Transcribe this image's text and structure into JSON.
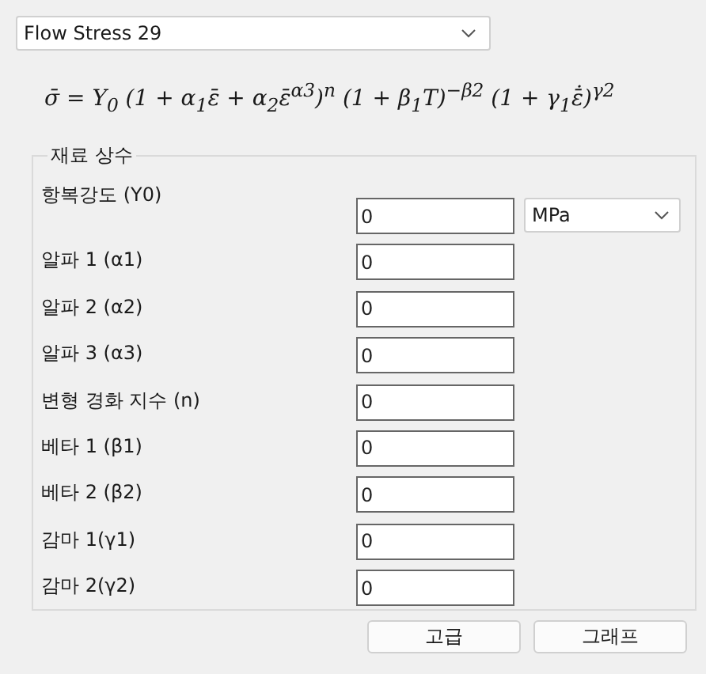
{
  "model_select": {
    "value": "Flow Stress 29"
  },
  "formula": "σ̄ = Y$_{0}$ (1 + α$_{1}$ε̄ + α$_{2}$ε̄$^{α3}$)$^{n}$ (1 + β$_{1}$T)$^{−β2}$ (1 + γ$_{1}$ε̄̇)$^{γ2}$",
  "group": {
    "title": "재료 상수",
    "parameters": [
      {
        "label": "항복강도 (Y0)",
        "value": "0",
        "unit": "MPa"
      },
      {
        "label": "알파 1 (α1)",
        "value": "0"
      },
      {
        "label": "알파 2 (α2)",
        "value": "0"
      },
      {
        "label": "알파 3 (α3)",
        "value": "0"
      },
      {
        "label": "변형 경화 지수 (n)",
        "value": "0"
      },
      {
        "label": "베타 1 (β1)",
        "value": "0"
      },
      {
        "label": "베타 2 (β2)",
        "value": "0"
      },
      {
        "label": "감마 1(γ1)",
        "value": "0"
      },
      {
        "label": "감마 2(γ2)",
        "value": "0"
      }
    ]
  },
  "buttons": [
    "고급",
    "그래프"
  ]
}
